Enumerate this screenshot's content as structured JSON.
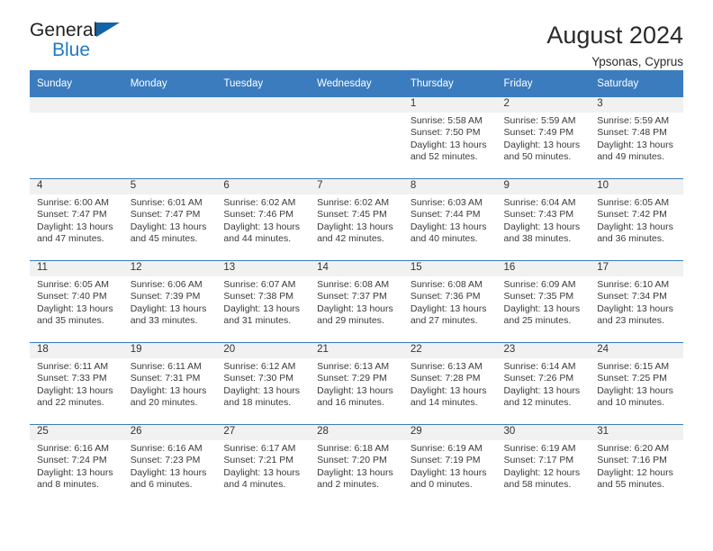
{
  "brand": {
    "name_top": "General",
    "name_bottom": "Blue",
    "accent_color": "#1163a8",
    "blue_text_color": "#1f7ac4"
  },
  "header": {
    "title": "August 2024",
    "location": "Ypsonas, Cyprus"
  },
  "calendar": {
    "header_bg": "#3b7cbf",
    "daynum_bg": "#f1f1f1",
    "weekday_names": [
      "Sunday",
      "Monday",
      "Tuesday",
      "Wednesday",
      "Thursday",
      "Friday",
      "Saturday"
    ],
    "weeks": [
      [
        {
          "day": "",
          "empty": true
        },
        {
          "day": "",
          "empty": true
        },
        {
          "day": "",
          "empty": true
        },
        {
          "day": "",
          "empty": true
        },
        {
          "day": "1",
          "sunrise": "Sunrise: 5:58 AM",
          "sunset": "Sunset: 7:50 PM",
          "daylight_line1": "Daylight: 13 hours",
          "daylight_line2": "and 52 minutes."
        },
        {
          "day": "2",
          "sunrise": "Sunrise: 5:59 AM",
          "sunset": "Sunset: 7:49 PM",
          "daylight_line1": "Daylight: 13 hours",
          "daylight_line2": "and 50 minutes."
        },
        {
          "day": "3",
          "sunrise": "Sunrise: 5:59 AM",
          "sunset": "Sunset: 7:48 PM",
          "daylight_line1": "Daylight: 13 hours",
          "daylight_line2": "and 49 minutes."
        }
      ],
      [
        {
          "day": "4",
          "sunrise": "Sunrise: 6:00 AM",
          "sunset": "Sunset: 7:47 PM",
          "daylight_line1": "Daylight: 13 hours",
          "daylight_line2": "and 47 minutes."
        },
        {
          "day": "5",
          "sunrise": "Sunrise: 6:01 AM",
          "sunset": "Sunset: 7:47 PM",
          "daylight_line1": "Daylight: 13 hours",
          "daylight_line2": "and 45 minutes."
        },
        {
          "day": "6",
          "sunrise": "Sunrise: 6:02 AM",
          "sunset": "Sunset: 7:46 PM",
          "daylight_line1": "Daylight: 13 hours",
          "daylight_line2": "and 44 minutes."
        },
        {
          "day": "7",
          "sunrise": "Sunrise: 6:02 AM",
          "sunset": "Sunset: 7:45 PM",
          "daylight_line1": "Daylight: 13 hours",
          "daylight_line2": "and 42 minutes."
        },
        {
          "day": "8",
          "sunrise": "Sunrise: 6:03 AM",
          "sunset": "Sunset: 7:44 PM",
          "daylight_line1": "Daylight: 13 hours",
          "daylight_line2": "and 40 minutes."
        },
        {
          "day": "9",
          "sunrise": "Sunrise: 6:04 AM",
          "sunset": "Sunset: 7:43 PM",
          "daylight_line1": "Daylight: 13 hours",
          "daylight_line2": "and 38 minutes."
        },
        {
          "day": "10",
          "sunrise": "Sunrise: 6:05 AM",
          "sunset": "Sunset: 7:42 PM",
          "daylight_line1": "Daylight: 13 hours",
          "daylight_line2": "and 36 minutes."
        }
      ],
      [
        {
          "day": "11",
          "sunrise": "Sunrise: 6:05 AM",
          "sunset": "Sunset: 7:40 PM",
          "daylight_line1": "Daylight: 13 hours",
          "daylight_line2": "and 35 minutes."
        },
        {
          "day": "12",
          "sunrise": "Sunrise: 6:06 AM",
          "sunset": "Sunset: 7:39 PM",
          "daylight_line1": "Daylight: 13 hours",
          "daylight_line2": "and 33 minutes."
        },
        {
          "day": "13",
          "sunrise": "Sunrise: 6:07 AM",
          "sunset": "Sunset: 7:38 PM",
          "daylight_line1": "Daylight: 13 hours",
          "daylight_line2": "and 31 minutes."
        },
        {
          "day": "14",
          "sunrise": "Sunrise: 6:08 AM",
          "sunset": "Sunset: 7:37 PM",
          "daylight_line1": "Daylight: 13 hours",
          "daylight_line2": "and 29 minutes."
        },
        {
          "day": "15",
          "sunrise": "Sunrise: 6:08 AM",
          "sunset": "Sunset: 7:36 PM",
          "daylight_line1": "Daylight: 13 hours",
          "daylight_line2": "and 27 minutes."
        },
        {
          "day": "16",
          "sunrise": "Sunrise: 6:09 AM",
          "sunset": "Sunset: 7:35 PM",
          "daylight_line1": "Daylight: 13 hours",
          "daylight_line2": "and 25 minutes."
        },
        {
          "day": "17",
          "sunrise": "Sunrise: 6:10 AM",
          "sunset": "Sunset: 7:34 PM",
          "daylight_line1": "Daylight: 13 hours",
          "daylight_line2": "and 23 minutes."
        }
      ],
      [
        {
          "day": "18",
          "sunrise": "Sunrise: 6:11 AM",
          "sunset": "Sunset: 7:33 PM",
          "daylight_line1": "Daylight: 13 hours",
          "daylight_line2": "and 22 minutes."
        },
        {
          "day": "19",
          "sunrise": "Sunrise: 6:11 AM",
          "sunset": "Sunset: 7:31 PM",
          "daylight_line1": "Daylight: 13 hours",
          "daylight_line2": "and 20 minutes."
        },
        {
          "day": "20",
          "sunrise": "Sunrise: 6:12 AM",
          "sunset": "Sunset: 7:30 PM",
          "daylight_line1": "Daylight: 13 hours",
          "daylight_line2": "and 18 minutes."
        },
        {
          "day": "21",
          "sunrise": "Sunrise: 6:13 AM",
          "sunset": "Sunset: 7:29 PM",
          "daylight_line1": "Daylight: 13 hours",
          "daylight_line2": "and 16 minutes."
        },
        {
          "day": "22",
          "sunrise": "Sunrise: 6:13 AM",
          "sunset": "Sunset: 7:28 PM",
          "daylight_line1": "Daylight: 13 hours",
          "daylight_line2": "and 14 minutes."
        },
        {
          "day": "23",
          "sunrise": "Sunrise: 6:14 AM",
          "sunset": "Sunset: 7:26 PM",
          "daylight_line1": "Daylight: 13 hours",
          "daylight_line2": "and 12 minutes."
        },
        {
          "day": "24",
          "sunrise": "Sunrise: 6:15 AM",
          "sunset": "Sunset: 7:25 PM",
          "daylight_line1": "Daylight: 13 hours",
          "daylight_line2": "and 10 minutes."
        }
      ],
      [
        {
          "day": "25",
          "sunrise": "Sunrise: 6:16 AM",
          "sunset": "Sunset: 7:24 PM",
          "daylight_line1": "Daylight: 13 hours",
          "daylight_line2": "and 8 minutes."
        },
        {
          "day": "26",
          "sunrise": "Sunrise: 6:16 AM",
          "sunset": "Sunset: 7:23 PM",
          "daylight_line1": "Daylight: 13 hours",
          "daylight_line2": "and 6 minutes."
        },
        {
          "day": "27",
          "sunrise": "Sunrise: 6:17 AM",
          "sunset": "Sunset: 7:21 PM",
          "daylight_line1": "Daylight: 13 hours",
          "daylight_line2": "and 4 minutes."
        },
        {
          "day": "28",
          "sunrise": "Sunrise: 6:18 AM",
          "sunset": "Sunset: 7:20 PM",
          "daylight_line1": "Daylight: 13 hours",
          "daylight_line2": "and 2 minutes."
        },
        {
          "day": "29",
          "sunrise": "Sunrise: 6:19 AM",
          "sunset": "Sunset: 7:19 PM",
          "daylight_line1": "Daylight: 13 hours",
          "daylight_line2": "and 0 minutes."
        },
        {
          "day": "30",
          "sunrise": "Sunrise: 6:19 AM",
          "sunset": "Sunset: 7:17 PM",
          "daylight_line1": "Daylight: 12 hours",
          "daylight_line2": "and 58 minutes."
        },
        {
          "day": "31",
          "sunrise": "Sunrise: 6:20 AM",
          "sunset": "Sunset: 7:16 PM",
          "daylight_line1": "Daylight: 12 hours",
          "daylight_line2": "and 55 minutes."
        }
      ]
    ]
  }
}
